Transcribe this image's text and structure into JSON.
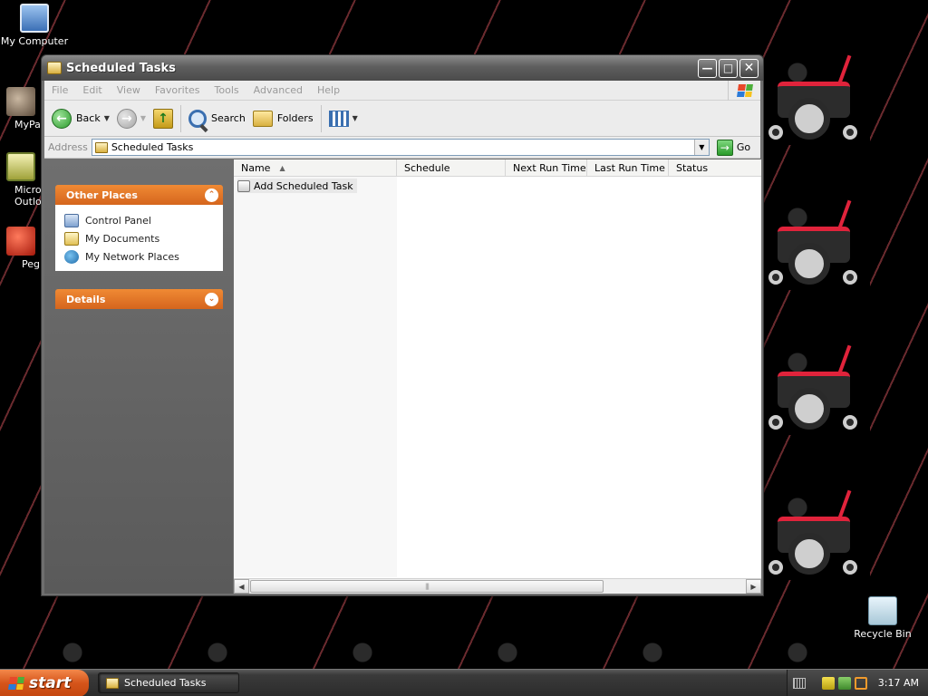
{
  "desktop": {
    "icons": [
      {
        "label": "My Computer"
      },
      {
        "label": "MyPa"
      },
      {
        "label": "Micros\nOutlo"
      },
      {
        "label": "Peg"
      },
      {
        "label": "Recycle Bin"
      }
    ]
  },
  "window": {
    "title": "Scheduled Tasks",
    "menu": [
      "File",
      "Edit",
      "View",
      "Favorites",
      "Tools",
      "Advanced",
      "Help"
    ],
    "toolbar": {
      "back_label": "Back",
      "search_label": "Search",
      "folders_label": "Folders"
    },
    "address": {
      "label": "Address",
      "value": "Scheduled Tasks",
      "go_label": "Go"
    },
    "taskpane": {
      "other_places": {
        "title": "Other Places",
        "links": [
          "Control Panel",
          "My Documents",
          "My Network Places"
        ]
      },
      "details": {
        "title": "Details"
      }
    },
    "list": {
      "columns": [
        "Name",
        "Schedule",
        "Next Run Time",
        "Last Run Time",
        "Status"
      ],
      "items": [
        "Add Scheduled Task"
      ]
    }
  },
  "taskbar": {
    "start_label": "start",
    "task_button": "Scheduled Tasks",
    "clock": "3:17 AM"
  },
  "colors": {
    "accent_orange": "#d5651d",
    "chair_red": "#e0233b"
  }
}
